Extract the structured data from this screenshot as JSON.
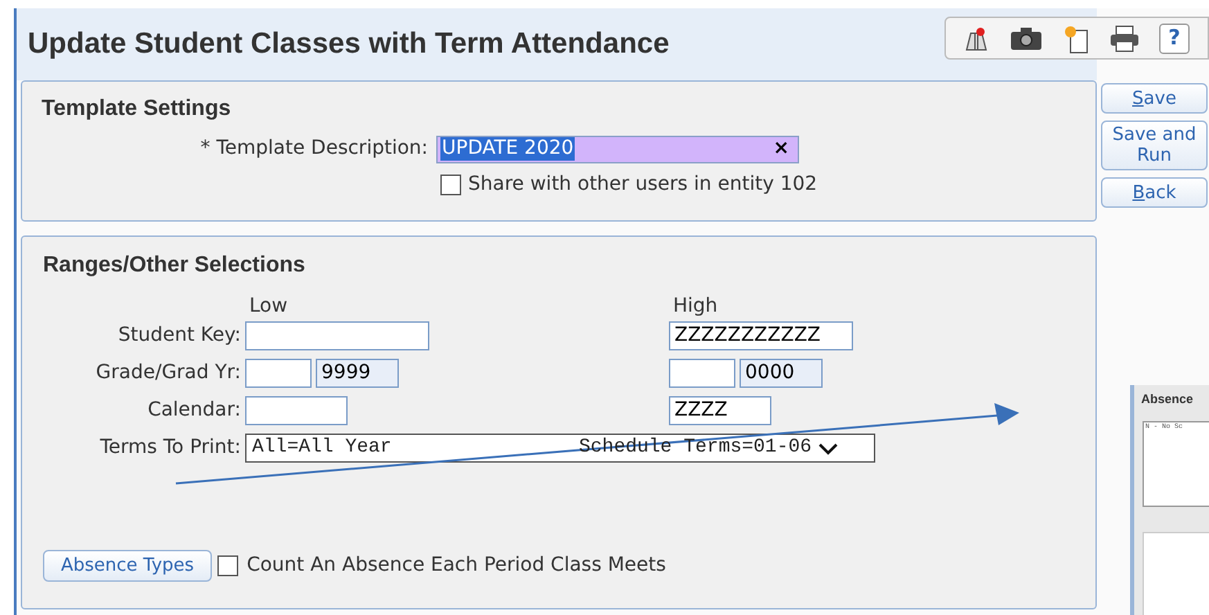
{
  "window": {
    "title": "Update Student Classes with Term Attendance"
  },
  "toolbar": {
    "help": "?"
  },
  "template_settings": {
    "title": "Template Settings",
    "description_label": "* Template Description:",
    "description_value": "UPDATE 2020",
    "description_selected": true,
    "clear": "×",
    "share_label": "Share with other users in entity 102",
    "share_checked": false
  },
  "actions": [
    {
      "label": "Save",
      "first_letter_underlined": true
    },
    {
      "label": "Save and Run",
      "first_letter_underlined": false
    },
    {
      "label": "Back",
      "first_letter_underlined": true
    }
  ],
  "ranges": {
    "title": "Ranges/Other Selections",
    "low_heading": "Low",
    "high_heading": "High",
    "rows": [
      {
        "kind": "single",
        "label": "Student Key:",
        "low": "",
        "high": "ZZZZZZZZZZZ"
      },
      {
        "kind": "pair",
        "label": "Grade/Grad Yr:",
        "low": "",
        "low_2": "9999",
        "high": "",
        "high_2": "0000"
      },
      {
        "kind": "calendar",
        "label": "Calendar:",
        "low": "",
        "high": "ZZZZ"
      },
      {
        "kind": "select",
        "label": "Terms To Print:",
        "value": "All=All Year",
        "value_2": "Schedule Terms=01-06"
      }
    ],
    "absence_button": "Absence Types",
    "count_label": "Count An Absence Each Period Class Meets",
    "count_checked": false
  },
  "inset": {
    "title": "Absence",
    "list_item": "N - No Sc"
  }
}
